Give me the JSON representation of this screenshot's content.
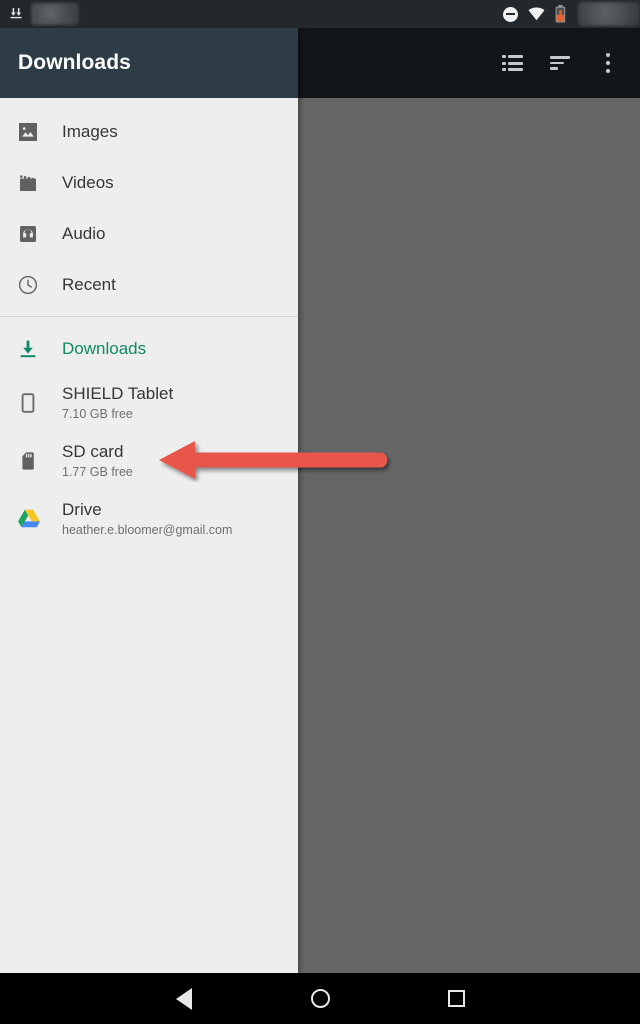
{
  "status_bar": {
    "left_icons": [
      "download-icon"
    ],
    "notification_placeholder": "",
    "right_icons": [
      "do-not-disturb-icon",
      "wifi-icon",
      "battery-low-icon"
    ],
    "clock_placeholder": ""
  },
  "toolbar": {
    "title": "Downloads",
    "actions": [
      {
        "name": "list-view",
        "label": "List view"
      },
      {
        "name": "sort",
        "label": "Sort"
      },
      {
        "name": "more-options",
        "label": "More options"
      }
    ]
  },
  "drawer": {
    "groups": [
      {
        "id": "shortcuts",
        "items": [
          {
            "icon": "image-icon",
            "label": "Images",
            "sub": "",
            "accent": false
          },
          {
            "icon": "video-icon",
            "label": "Videos",
            "sub": "",
            "accent": false
          },
          {
            "icon": "audio-icon",
            "label": "Audio",
            "sub": "",
            "accent": false
          },
          {
            "icon": "recent-icon",
            "label": "Recent",
            "sub": "",
            "accent": false
          }
        ]
      },
      {
        "id": "roots",
        "items": [
          {
            "icon": "download-icon",
            "label": "Downloads",
            "sub": "",
            "accent": true
          },
          {
            "icon": "tablet-icon",
            "label": "SHIELD Tablet",
            "sub": "7.10 GB free",
            "accent": false
          },
          {
            "icon": "sdcard-icon",
            "label": "SD card",
            "sub": "1.77 GB free",
            "accent": false
          },
          {
            "icon": "drive-icon",
            "label": "Drive",
            "sub": "heather.e.bloomer@gmail.com",
            "accent": false
          }
        ]
      }
    ]
  },
  "annotation": {
    "type": "arrow",
    "direction": "left",
    "color": "#e8574a",
    "points_at": "SD card"
  },
  "navigation_bar": {
    "buttons": [
      {
        "name": "back-button",
        "label": "Back"
      },
      {
        "name": "home-button",
        "label": "Home"
      },
      {
        "name": "recents-button",
        "label": "Recents"
      }
    ]
  },
  "colors": {
    "drawer_header": "#2e3d45",
    "toolbar": "#111619",
    "status_bar": "#22282b",
    "drawer_bg": "#eeeeee",
    "scrim": "#666666",
    "accent": "#0f8a68",
    "annotation": "#e8574a"
  }
}
